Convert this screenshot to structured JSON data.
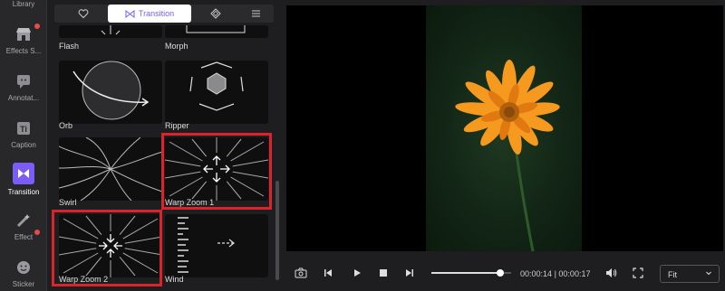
{
  "sidebar": {
    "items": [
      {
        "label": "Library"
      },
      {
        "label": "Effects S..."
      },
      {
        "label": "Annotat..."
      },
      {
        "label": "Caption"
      },
      {
        "label": "Transition"
      },
      {
        "label": "Effect"
      },
      {
        "label": "Sticker"
      }
    ]
  },
  "panel": {
    "active_tab_label": "Transition",
    "tiles": [
      {
        "label": "Flash"
      },
      {
        "label": "Morph"
      },
      {
        "label": "Orb"
      },
      {
        "label": "Ripper"
      },
      {
        "label": "Swirl"
      },
      {
        "label": "Warp Zoom 1"
      },
      {
        "label": "Warp Zoom 2"
      },
      {
        "label": "Wind"
      }
    ]
  },
  "player": {
    "current_time": "00:00:14",
    "separator": "|",
    "total_time": "00:00:17",
    "progress": 0.86,
    "fit_value": "Fit"
  },
  "colors": {
    "accent": "#7b5cf5",
    "highlight": "#d9242b",
    "flower": "#f59a1e"
  }
}
